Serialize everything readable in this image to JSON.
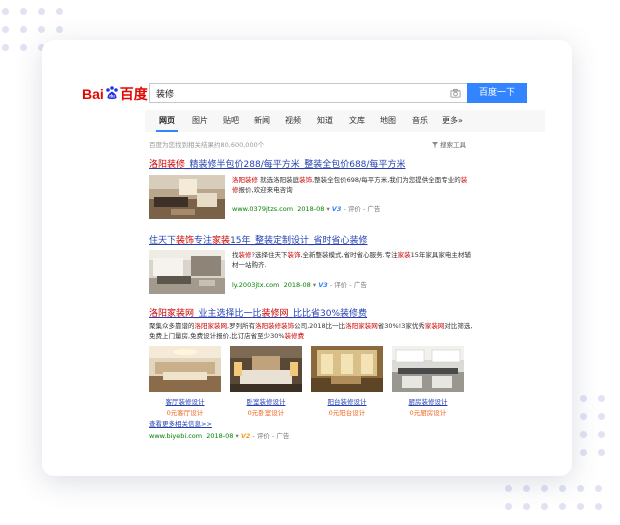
{
  "logo": {
    "part1": "Bai",
    "part2": "百度"
  },
  "search": {
    "query": "装修",
    "button_label": "百度一下"
  },
  "tabs": [
    {
      "label": "网页",
      "active": true
    },
    {
      "label": "图片"
    },
    {
      "label": "贴吧"
    },
    {
      "label": "新闻"
    },
    {
      "label": "视频"
    },
    {
      "label": "知道"
    },
    {
      "label": "文库"
    },
    {
      "label": "地图"
    },
    {
      "label": "音乐"
    },
    {
      "label": "更多»"
    }
  ],
  "result_count": "百度为您找到相关结果约80,600,000个",
  "search_tools": "搜索工具",
  "results": [
    {
      "title_hl1": "洛阳装修",
      "title_rest": "_精装修半包价288/每平方米_整装全包价688/每平方米",
      "desc_hl1": "洛阳装修",
      "desc_mid1": " 就选洛阳装庭",
      "desc_hl2": "装饰",
      "desc_mid2": ",整装全包价698/每平方米,我们为您提供全面专业的",
      "desc_hl3": "装修",
      "desc_rest": "报价,欢迎来电咨询",
      "url": "www.0379jtzs.com",
      "date": "2018-08",
      "v_badge": "V3",
      "eval": "评价",
      "ad": "广告"
    },
    {
      "title_part1": "住天下",
      "title_hl1": "装饰",
      "title_part2": "专注",
      "title_hl2": "家装",
      "title_rest": "15年_整装定制设计_省时省心装修",
      "desc_part1": "找",
      "desc_hl1": "装修",
      "desc_mid1": "?选择住天下",
      "desc_hl2": "装饰",
      "desc_mid2": ",全新整装模式,省时省心服务.专注",
      "desc_hl3": "家装",
      "desc_rest": "15年家具家电主材辅材一站购齐.",
      "url": "ly.2003jtx.com",
      "date": "2018-08",
      "v_badge": "V3",
      "eval": "评价",
      "ad": "广告"
    },
    {
      "title_hl1": "洛阳家装网",
      "title_part1": "_业主选择比一比",
      "title_hl2": "装修网",
      "title_rest": "_比比省30%装修费",
      "desc_part1": "聚集众多靠谱的",
      "desc_hl1": "洛阳家装网",
      "desc_mid1": ",罗列所有",
      "desc_hl2": "洛阳装修装饰",
      "desc_mid2": "公司,2018比一比",
      "desc_hl3": "洛阳家装网",
      "desc_mid3": "省30%!3家优秀",
      "desc_hl4": "家装网",
      "desc_rest": "对比筛选,免费上门量房,免费设计报价,比订店省至少30%",
      "desc_hl5": "装修费",
      "gallery": [
        {
          "label": "客厅装修设计",
          "price": "0元客厅设计"
        },
        {
          "label": "卧室装修设计",
          "price": "0元卧室设计"
        },
        {
          "label": "阳台装修设计",
          "price": "0元阳台设计"
        },
        {
          "label": "厨房装修设计",
          "price": "0元厨房设计"
        }
      ],
      "more": "查看更多相关信息>>",
      "url": "www.biyebi.com",
      "date": "2018-08",
      "v_badge": "V2",
      "eval": "评价",
      "ad": "广告"
    }
  ],
  "colors": {
    "accent": "#3385ff",
    "highlight": "#cc0000",
    "url": "#008000",
    "link": "#2440b3",
    "price": "#f26522"
  }
}
